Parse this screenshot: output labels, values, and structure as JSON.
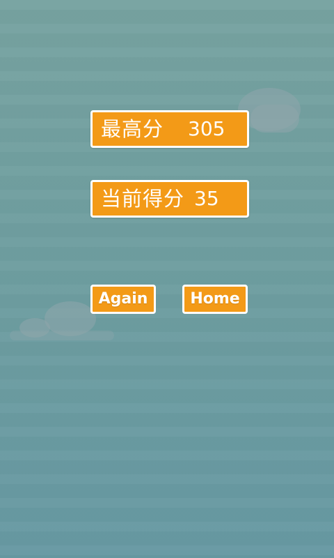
{
  "scores": {
    "best_label": "最高分",
    "best_value": "305",
    "current_label": "当前得分",
    "current_value": "35"
  },
  "buttons": {
    "again_label": "Again",
    "home_label": "Home"
  },
  "colors": {
    "accent": "#f39a17",
    "background": "#6f9ea0",
    "text": "#ffffff"
  }
}
